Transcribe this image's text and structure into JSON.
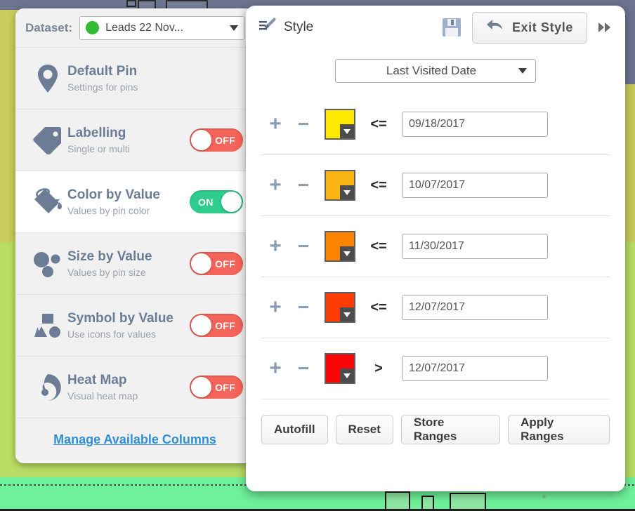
{
  "dataset_bar": {
    "label": "Dataset:",
    "value": "Leads 22 Nov...",
    "dot_color": "#33bb33",
    "caret_icon": "caret-down-icon"
  },
  "sidebar": {
    "items": [
      {
        "title": "Default Pin",
        "subtitle": "Settings for pins",
        "icon": "map-pin-icon",
        "toggle": null
      },
      {
        "title": "Labelling",
        "subtitle": "Single or multi",
        "icon": "tag-icon",
        "toggle": "OFF"
      },
      {
        "title": "Color by Value",
        "subtitle": "Values by pin color",
        "icon": "paint-bucket-icon",
        "toggle": "ON"
      },
      {
        "title": "Size by Value",
        "subtitle": "Values by pin size",
        "icon": "circles-icon",
        "toggle": "OFF"
      },
      {
        "title": "Symbol by Value",
        "subtitle": "Use icons for values",
        "icon": "shapes-icon",
        "toggle": "OFF"
      },
      {
        "title": "Heat Map",
        "subtitle": "Visual heat map",
        "icon": "heatmap-swirl-icon",
        "toggle": "OFF"
      }
    ],
    "manage_link": "Manage Available Columns"
  },
  "style_panel": {
    "title": "Style",
    "title_icon": "paintbrush-icon",
    "save_icon": "floppy-disk-icon",
    "exit_label": "Exit Style",
    "exit_icon": "undo-arrow-icon",
    "collapse_icon": "double-chevron-right-icon",
    "field_select": {
      "value": "Last Visited Date",
      "caret_icon": "caret-down-icon"
    },
    "rules": [
      {
        "add_label": "+",
        "remove_label": "−",
        "color": "#ffe800",
        "operator": "<=",
        "value": "09/18/2017"
      },
      {
        "add_label": "+",
        "remove_label": "−",
        "color": "#fbb515",
        "operator": "<=",
        "value": "10/07/2017"
      },
      {
        "add_label": "+",
        "remove_label": "−",
        "color": "#fb8400",
        "operator": "<=",
        "value": "11/30/2017"
      },
      {
        "add_label": "+",
        "remove_label": "−",
        "color": "#fb3c05",
        "operator": "<=",
        "value": "12/07/2017"
      },
      {
        "add_label": "+",
        "remove_label": "−",
        "color": "#fb0606",
        "operator": ">",
        "value": "12/07/2017"
      }
    ],
    "actions": [
      {
        "label": "Autofill"
      },
      {
        "label": "Reset"
      },
      {
        "label": "Store Ranges"
      },
      {
        "label": "Apply Ranges"
      }
    ]
  },
  "colors": {
    "toggle_off": "#f4645a",
    "toggle_on": "#2ecc8f",
    "link": "#2f8fd4",
    "sidebar_text": "#6b7c94",
    "map_olive": "#c9cd5c",
    "map_lime": "#b9dd63",
    "map_green": "#6ff09a"
  }
}
